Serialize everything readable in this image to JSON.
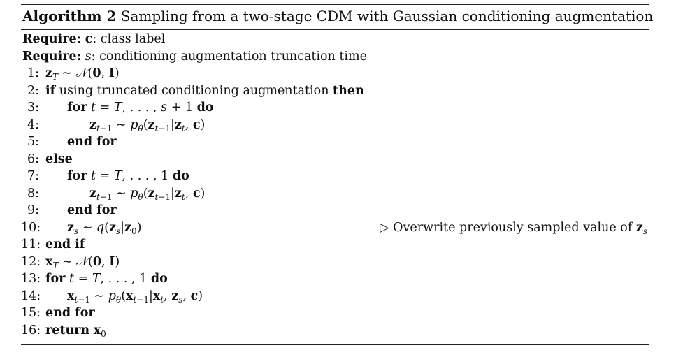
{
  "caption": {
    "label": "Algorithm 2",
    "title": "Sampling from a two-stage CDM with Gaussian conditioning augmentation"
  },
  "requires": [
    {
      "keyword": "Require:",
      "var": "c",
      "desc": ": class label"
    },
    {
      "keyword": "Require:",
      "var": "s",
      "desc": ": conditioning augmentation truncation time"
    }
  ],
  "lines": [
    {
      "num": "1:",
      "text": "z_T ~ 𝒩(0, I)"
    },
    {
      "num": "2:",
      "kw1": "if",
      "text": " using truncated conditioning augmentation ",
      "kw2": "then"
    },
    {
      "num": "3:",
      "kw1": "for",
      "text": " t = T, . . . , s + 1 ",
      "kw2": "do"
    },
    {
      "num": "4:",
      "text": "z_{t−1} ~ p_θ(z_{t−1}|z_t, c)"
    },
    {
      "num": "5:",
      "kw1": "end for"
    },
    {
      "num": "6:",
      "kw1": "else"
    },
    {
      "num": "7:",
      "kw1": "for",
      "text": " t = T, . . . , 1 ",
      "kw2": "do"
    },
    {
      "num": "8:",
      "text": "z_{t−1} ~ p_θ(z_{t−1}|z_t, c)"
    },
    {
      "num": "9:",
      "kw1": "end for"
    },
    {
      "num": "10:",
      "text": "z_s ~ q(z_s|z_0)",
      "comment": "▷ Overwrite previously sampled value of z_s"
    },
    {
      "num": "11:",
      "kw1": "end if"
    },
    {
      "num": "12:",
      "text": "x_T ~ 𝒩(0, I)"
    },
    {
      "num": "13:",
      "kw1": "for",
      "text": " t = T, . . . , 1 ",
      "kw2": "do"
    },
    {
      "num": "14:",
      "text": "x_{t−1} ~ p_θ(x_{t−1}|x_t, z_s, c)"
    },
    {
      "num": "15:",
      "kw1": "end for"
    },
    {
      "num": "16:",
      "kw1": "return",
      "text": "x_0"
    }
  ]
}
